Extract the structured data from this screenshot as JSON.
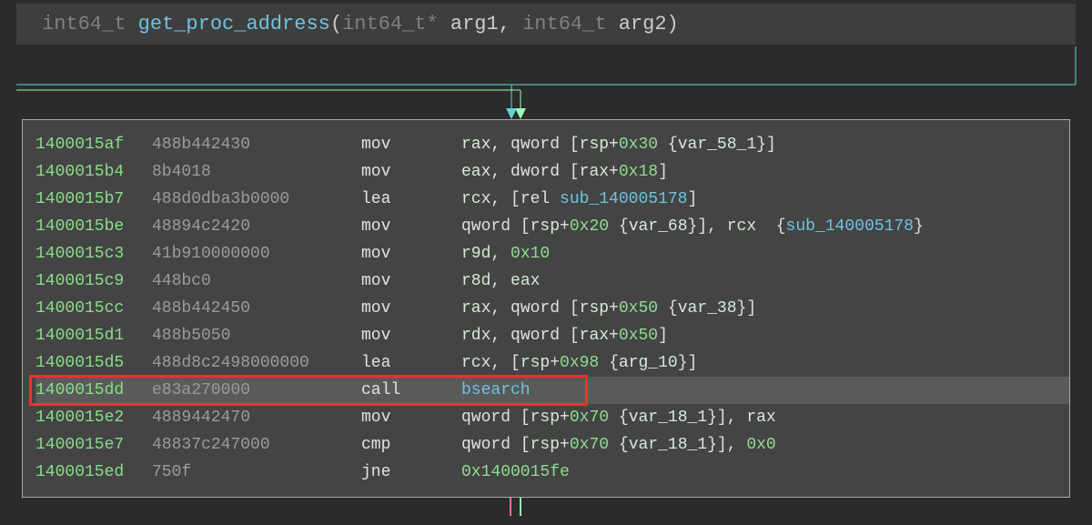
{
  "signature": {
    "return_type": "int64_t",
    "name": "get_proc_address",
    "params": [
      {
        "type": "int64_t*",
        "name": "arg1"
      },
      {
        "type": "int64_t",
        "name": "arg2"
      }
    ]
  },
  "colors": {
    "background": "#2b2b2b",
    "panel": "#444444",
    "sig_bg": "#3e3e3e",
    "border": "#aaaaaa",
    "flow_cyan": "#5fd7d7",
    "flow_green": "#9dfab2",
    "flow_red": "#ff6b9d",
    "highlight_border": "#ff2a2a",
    "selected_row": "#5a5a5a"
  },
  "highlighted_index": 9,
  "rows": [
    {
      "addr": "1400015af",
      "bytes": "488b442430",
      "mnem": "mov",
      "ops": [
        {
          "t": "reg",
          "v": "rax"
        },
        {
          "t": "p",
          "v": ", "
        },
        {
          "t": "kw",
          "v": "qword "
        },
        {
          "t": "p",
          "v": "["
        },
        {
          "t": "reg",
          "v": "rsp"
        },
        {
          "t": "p",
          "v": "+"
        },
        {
          "t": "num",
          "v": "0x30"
        },
        {
          "t": "p",
          "v": " "
        },
        {
          "t": "brace",
          "v": "{"
        },
        {
          "t": "var",
          "v": "var_58_1"
        },
        {
          "t": "brace",
          "v": "}"
        },
        {
          "t": "p",
          "v": "]"
        }
      ]
    },
    {
      "addr": "1400015b4",
      "bytes": "8b4018",
      "mnem": "mov",
      "ops": [
        {
          "t": "reg",
          "v": "eax"
        },
        {
          "t": "p",
          "v": ", "
        },
        {
          "t": "kw",
          "v": "dword "
        },
        {
          "t": "p",
          "v": "["
        },
        {
          "t": "reg",
          "v": "rax"
        },
        {
          "t": "p",
          "v": "+"
        },
        {
          "t": "num",
          "v": "0x18"
        },
        {
          "t": "p",
          "v": "]"
        }
      ]
    },
    {
      "addr": "1400015b7",
      "bytes": "488d0dba3b0000",
      "mnem": "lea",
      "ops": [
        {
          "t": "reg",
          "v": "rcx"
        },
        {
          "t": "p",
          "v": ", ["
        },
        {
          "t": "kw",
          "v": "rel "
        },
        {
          "t": "ref",
          "v": "sub_140005178"
        },
        {
          "t": "p",
          "v": "]"
        }
      ]
    },
    {
      "addr": "1400015be",
      "bytes": "48894c2420",
      "mnem": "mov",
      "ops": [
        {
          "t": "kw",
          "v": "qword "
        },
        {
          "t": "p",
          "v": "["
        },
        {
          "t": "reg",
          "v": "rsp"
        },
        {
          "t": "p",
          "v": "+"
        },
        {
          "t": "num",
          "v": "0x20"
        },
        {
          "t": "p",
          "v": " "
        },
        {
          "t": "brace",
          "v": "{"
        },
        {
          "t": "var",
          "v": "var_68"
        },
        {
          "t": "brace",
          "v": "}"
        },
        {
          "t": "p",
          "v": "], "
        },
        {
          "t": "reg",
          "v": "rcx"
        },
        {
          "t": "p",
          "v": "  "
        },
        {
          "t": "brace",
          "v": "{"
        },
        {
          "t": "ref",
          "v": "sub_140005178"
        },
        {
          "t": "brace",
          "v": "}"
        }
      ]
    },
    {
      "addr": "1400015c3",
      "bytes": "41b910000000",
      "mnem": "mov",
      "ops": [
        {
          "t": "reg",
          "v": "r9d"
        },
        {
          "t": "p",
          "v": ", "
        },
        {
          "t": "num",
          "v": "0x10"
        }
      ]
    },
    {
      "addr": "1400015c9",
      "bytes": "448bc0",
      "mnem": "mov",
      "ops": [
        {
          "t": "reg",
          "v": "r8d"
        },
        {
          "t": "p",
          "v": ", "
        },
        {
          "t": "reg",
          "v": "eax"
        }
      ]
    },
    {
      "addr": "1400015cc",
      "bytes": "488b442450",
      "mnem": "mov",
      "ops": [
        {
          "t": "reg",
          "v": "rax"
        },
        {
          "t": "p",
          "v": ", "
        },
        {
          "t": "kw",
          "v": "qword "
        },
        {
          "t": "p",
          "v": "["
        },
        {
          "t": "reg",
          "v": "rsp"
        },
        {
          "t": "p",
          "v": "+"
        },
        {
          "t": "num",
          "v": "0x50"
        },
        {
          "t": "p",
          "v": " "
        },
        {
          "t": "brace",
          "v": "{"
        },
        {
          "t": "var",
          "v": "var_38"
        },
        {
          "t": "brace",
          "v": "}"
        },
        {
          "t": "p",
          "v": "]"
        }
      ]
    },
    {
      "addr": "1400015d1",
      "bytes": "488b5050",
      "mnem": "mov",
      "ops": [
        {
          "t": "reg",
          "v": "rdx"
        },
        {
          "t": "p",
          "v": ", "
        },
        {
          "t": "kw",
          "v": "qword "
        },
        {
          "t": "p",
          "v": "["
        },
        {
          "t": "reg",
          "v": "rax"
        },
        {
          "t": "p",
          "v": "+"
        },
        {
          "t": "num",
          "v": "0x50"
        },
        {
          "t": "p",
          "v": "]"
        }
      ]
    },
    {
      "addr": "1400015d5",
      "bytes": "488d8c2498000000",
      "mnem": "lea",
      "ops": [
        {
          "t": "reg",
          "v": "rcx"
        },
        {
          "t": "p",
          "v": ", ["
        },
        {
          "t": "reg",
          "v": "rsp"
        },
        {
          "t": "p",
          "v": "+"
        },
        {
          "t": "num",
          "v": "0x98"
        },
        {
          "t": "p",
          "v": " "
        },
        {
          "t": "brace",
          "v": "{"
        },
        {
          "t": "var",
          "v": "arg_10"
        },
        {
          "t": "brace",
          "v": "}"
        },
        {
          "t": "p",
          "v": "]"
        }
      ]
    },
    {
      "addr": "1400015dd",
      "bytes": "e83a270000",
      "mnem": "call",
      "ops": [
        {
          "t": "ref",
          "v": "bsearch"
        }
      ],
      "selected": true
    },
    {
      "addr": "1400015e2",
      "bytes": "4889442470",
      "mnem": "mov",
      "ops": [
        {
          "t": "kw",
          "v": "qword "
        },
        {
          "t": "p",
          "v": "["
        },
        {
          "t": "reg",
          "v": "rsp"
        },
        {
          "t": "p",
          "v": "+"
        },
        {
          "t": "num",
          "v": "0x70"
        },
        {
          "t": "p",
          "v": " "
        },
        {
          "t": "brace",
          "v": "{"
        },
        {
          "t": "var",
          "v": "var_18_1"
        },
        {
          "t": "brace",
          "v": "}"
        },
        {
          "t": "p",
          "v": "], "
        },
        {
          "t": "reg",
          "v": "rax"
        }
      ]
    },
    {
      "addr": "1400015e7",
      "bytes": "48837c247000",
      "mnem": "cmp",
      "ops": [
        {
          "t": "kw",
          "v": "qword "
        },
        {
          "t": "p",
          "v": "["
        },
        {
          "t": "reg",
          "v": "rsp"
        },
        {
          "t": "p",
          "v": "+"
        },
        {
          "t": "num",
          "v": "0x70"
        },
        {
          "t": "p",
          "v": " "
        },
        {
          "t": "brace",
          "v": "{"
        },
        {
          "t": "var",
          "v": "var_18_1"
        },
        {
          "t": "brace",
          "v": "}"
        },
        {
          "t": "p",
          "v": "], "
        },
        {
          "t": "num",
          "v": "0x0"
        }
      ]
    },
    {
      "addr": "1400015ed",
      "bytes": "750f",
      "mnem": "jne",
      "ops": [
        {
          "t": "num",
          "v": "0x1400015fe"
        }
      ]
    }
  ]
}
